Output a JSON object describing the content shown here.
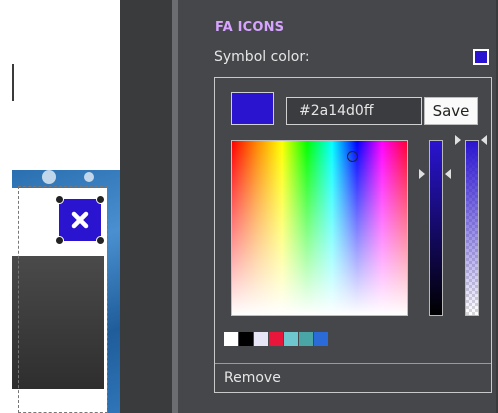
{
  "panel": {
    "title": "FA ICONS",
    "symbol_color_label": "Symbol color:",
    "symbol_color": "#2a14d0"
  },
  "color_picker": {
    "current_color": "#2a14d0",
    "hex_value": "#2a14d0ff",
    "save_label": "Save",
    "remove_label": "Remove",
    "presets": [
      "#ffffff",
      "#000000",
      "#e5e5f5",
      "#e8163a",
      "#6ec7cf",
      "#4aa6a6",
      "#2a6bd8"
    ]
  },
  "canvas": {
    "icon_symbol": "✖",
    "icon_name": "close-icon",
    "icon_background": "#2a14d0"
  }
}
